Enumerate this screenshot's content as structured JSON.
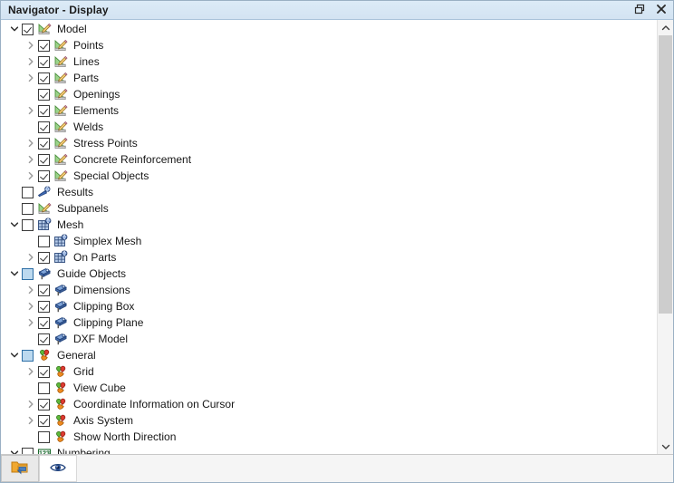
{
  "window": {
    "title": "Navigator - Display",
    "buttons": [
      {
        "name": "restore-button",
        "icon": "restore-icon",
        "label": ""
      },
      {
        "name": "close-button",
        "icon": "close-icon",
        "label": ""
      }
    ]
  },
  "scrollbar": {
    "up_arrow": "chevron-up-icon",
    "down_arrow": "chevron-down-icon",
    "thumb_top_percent": 0,
    "thumb_height_percent": 69
  },
  "toolbar": {
    "buttons": [
      {
        "name": "display-properties-button",
        "icon": "display-properties-icon",
        "label": "",
        "active": true
      },
      {
        "name": "visibility-button",
        "icon": "eye-icon",
        "label": "",
        "active": false
      }
    ]
  },
  "tree": {
    "items": [
      {
        "label": "Model",
        "level": 0,
        "expander": "expanded",
        "check": "checked",
        "icon": "model-icon"
      },
      {
        "label": "Points",
        "level": 1,
        "expander": "collapsed",
        "check": "checked",
        "icon": "model-icon"
      },
      {
        "label": "Lines",
        "level": 1,
        "expander": "collapsed",
        "check": "checked",
        "icon": "model-icon"
      },
      {
        "label": "Parts",
        "level": 1,
        "expander": "collapsed",
        "check": "checked",
        "icon": "model-icon"
      },
      {
        "label": "Openings",
        "level": 1,
        "expander": "none",
        "check": "checked",
        "icon": "model-icon"
      },
      {
        "label": "Elements",
        "level": 1,
        "expander": "collapsed",
        "check": "checked",
        "icon": "model-icon"
      },
      {
        "label": "Welds",
        "level": 1,
        "expander": "none",
        "check": "checked",
        "icon": "model-icon"
      },
      {
        "label": "Stress Points",
        "level": 1,
        "expander": "collapsed",
        "check": "checked",
        "icon": "model-icon"
      },
      {
        "label": "Concrete Reinforcement",
        "level": 1,
        "expander": "collapsed",
        "check": "checked",
        "icon": "model-icon"
      },
      {
        "label": "Special Objects",
        "level": 1,
        "expander": "collapsed",
        "check": "checked",
        "icon": "model-icon"
      },
      {
        "label": "Results",
        "level": 0,
        "expander": "none",
        "check": "unchecked",
        "icon": "results-icon"
      },
      {
        "label": "Subpanels",
        "level": 0,
        "expander": "none",
        "check": "unchecked",
        "icon": "model-icon"
      },
      {
        "label": "Mesh",
        "level": 0,
        "expander": "expanded",
        "check": "unchecked",
        "icon": "mesh-icon"
      },
      {
        "label": "Simplex Mesh",
        "level": 1,
        "expander": "none",
        "check": "unchecked",
        "icon": "mesh-icon"
      },
      {
        "label": "On Parts",
        "level": 1,
        "expander": "collapsed",
        "check": "checked",
        "icon": "mesh-icon"
      },
      {
        "label": "Guide Objects",
        "level": 0,
        "expander": "expanded",
        "check": "partial",
        "icon": "guide-icon"
      },
      {
        "label": "Dimensions",
        "level": 1,
        "expander": "collapsed",
        "check": "checked",
        "icon": "guide-icon"
      },
      {
        "label": "Clipping Box",
        "level": 1,
        "expander": "collapsed",
        "check": "checked",
        "icon": "guide-icon"
      },
      {
        "label": "Clipping Plane",
        "level": 1,
        "expander": "collapsed",
        "check": "checked",
        "icon": "guide-icon"
      },
      {
        "label": "DXF Model",
        "level": 1,
        "expander": "none",
        "check": "checked",
        "icon": "guide-icon"
      },
      {
        "label": "General",
        "level": 0,
        "expander": "expanded",
        "check": "partial",
        "icon": "general-icon"
      },
      {
        "label": "Grid",
        "level": 1,
        "expander": "collapsed",
        "check": "checked",
        "icon": "general-icon"
      },
      {
        "label": "View Cube",
        "level": 1,
        "expander": "none",
        "check": "unchecked",
        "icon": "general-icon"
      },
      {
        "label": "Coordinate Information on Cursor",
        "level": 1,
        "expander": "collapsed",
        "check": "checked",
        "icon": "general-icon"
      },
      {
        "label": "Axis System",
        "level": 1,
        "expander": "collapsed",
        "check": "checked",
        "icon": "general-icon"
      },
      {
        "label": "Show North Direction",
        "level": 1,
        "expander": "none",
        "check": "unchecked",
        "icon": "general-icon"
      },
      {
        "label": "Numbering",
        "level": 0,
        "expander": "expanded",
        "check": "unchecked",
        "icon": "numbering-icon"
      }
    ]
  },
  "colors": {
    "titlebar": "#d6e5f3",
    "accent": "#2e6fa6",
    "partial_check_fill": "#bcd9ef"
  }
}
